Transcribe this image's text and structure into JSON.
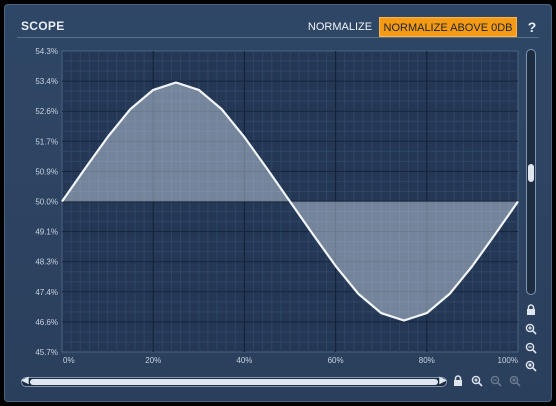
{
  "header": {
    "title": "SCOPE",
    "normalize_label": "NORMALIZE",
    "normalize_above_label": "NORMALIZE ABOVE 0DB",
    "help_label": "?"
  },
  "colors": {
    "panel": "#2f4766",
    "plot_bg": "#243856",
    "accent": "#f59a14",
    "wave": "#f2f5f8"
  },
  "icons": {
    "vertical_lock": "lock-icon",
    "zoom_in": "zoom-in-icon",
    "zoom_out": "zoom-out-icon",
    "zoom_reset": "zoom-reset-icon",
    "horizontal_lock": "lock-icon"
  },
  "chart_data": {
    "type": "area",
    "title": "",
    "xlabel": "",
    "ylabel": "",
    "x_ticks": [
      "0%",
      "20%",
      "40%",
      "60%",
      "80%",
      "100%"
    ],
    "y_ticks": [
      "54.3%",
      "53.4%",
      "52.6%",
      "51.7%",
      "50.9%",
      "50.0%",
      "49.1%",
      "48.3%",
      "47.4%",
      "46.6%",
      "45.7%"
    ],
    "xlim": [
      0,
      100
    ],
    "ylim": [
      45.7,
      54.3
    ],
    "baseline": 50.0,
    "grid": true,
    "series": [
      {
        "x": [
          0,
          5,
          10,
          15,
          20,
          25,
          30,
          35,
          40,
          45,
          50,
          55,
          60,
          65,
          70,
          75,
          80,
          85,
          90,
          95,
          100
        ],
        "y": [
          50.0,
          50.93,
          51.84,
          52.64,
          53.19,
          53.4,
          53.19,
          52.64,
          51.84,
          50.93,
          50.0,
          49.07,
          48.16,
          47.36,
          46.81,
          46.6,
          46.81,
          47.36,
          48.16,
          49.07,
          50.0
        ]
      }
    ]
  }
}
